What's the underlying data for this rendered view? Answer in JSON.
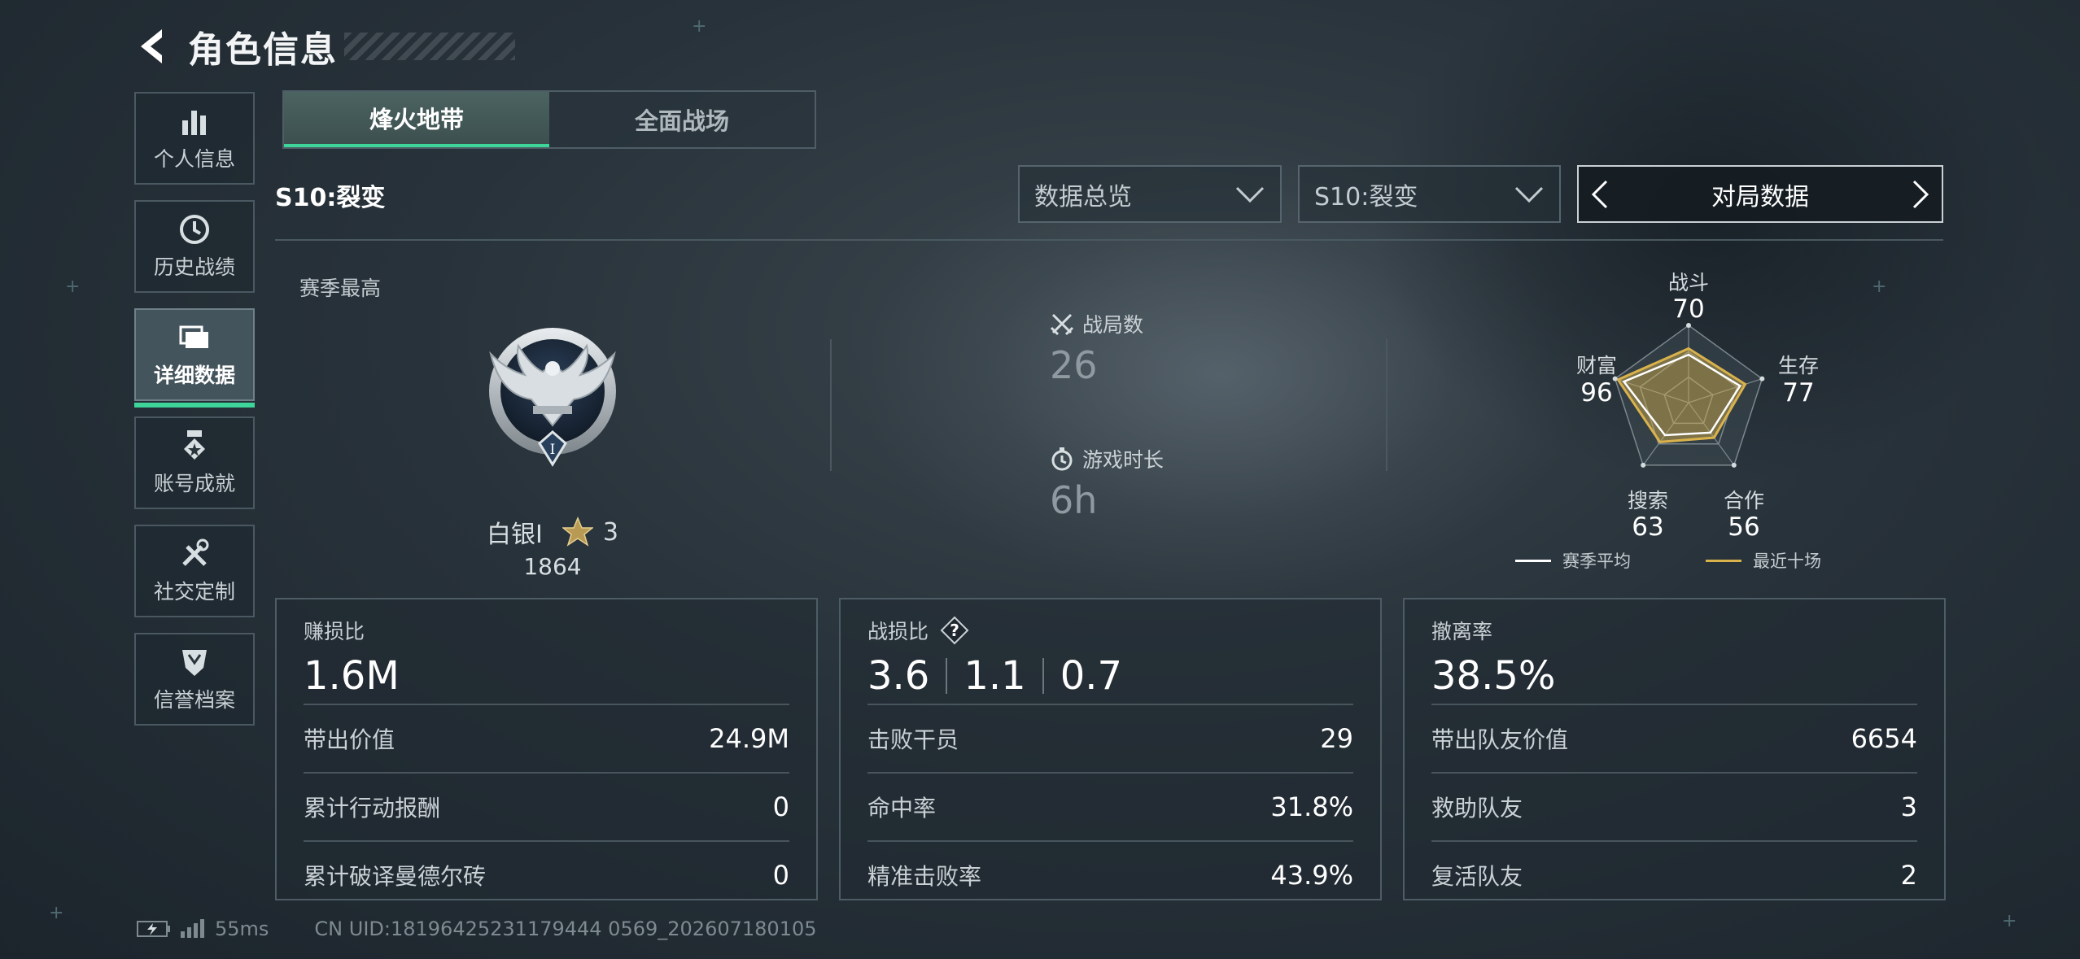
{
  "header": {
    "title": "角色信息"
  },
  "nav": {
    "items": [
      {
        "label": "个人信息",
        "icon": "bar-chart-icon"
      },
      {
        "label": "历史战绩",
        "icon": "clock-icon"
      },
      {
        "label": "详细数据",
        "icon": "folder-icon",
        "active": true
      },
      {
        "label": "账号成就",
        "icon": "medal-icon"
      },
      {
        "label": "社交定制",
        "icon": "tools-icon"
      },
      {
        "label": "信誉档案",
        "icon": "shield-icon"
      }
    ]
  },
  "mode_tabs": [
    {
      "label": "烽火地带",
      "active": true
    },
    {
      "label": "全面战场",
      "active": false
    }
  ],
  "season_label": "S10:裂变",
  "filters": {
    "overview": "数据总览",
    "season": "S10:裂变",
    "pager_label": "对局数据"
  },
  "overview": {
    "season_best_label": "赛季最高",
    "rank_name": "白银I",
    "rank_stars": "3",
    "rank_score": "1864",
    "badge_numeral": "I",
    "matches_label": "战局数",
    "matches_value": "26",
    "playtime_label": "游戏时长",
    "playtime_value": "6h"
  },
  "radar": {
    "axes": [
      {
        "label": "战斗",
        "value": "70"
      },
      {
        "label": "生存",
        "value": "77"
      },
      {
        "label": "合作",
        "value": "56"
      },
      {
        "label": "搜索",
        "value": "63"
      },
      {
        "label": "财富",
        "value": "96"
      }
    ],
    "season_avg": [
      0.62,
      0.7,
      0.48,
      0.52,
      0.88
    ],
    "recent_ten": [
      0.7,
      0.77,
      0.56,
      0.63,
      0.96
    ],
    "legend": {
      "season_avg": "赛季平均",
      "recent_ten": "最近十场"
    },
    "colors": {
      "season_avg": "#ffffff",
      "recent_ten": "#d9b24c"
    }
  },
  "cards": [
    {
      "title": "赚损比",
      "main": [
        "1.6M"
      ],
      "rows": [
        {
          "label": "带出价值",
          "value": "24.9M"
        },
        {
          "label": "累计行动报酬",
          "value": "0"
        },
        {
          "label": "累计破译曼德尔砖",
          "value": "0"
        }
      ]
    },
    {
      "title": "战损比",
      "help_icon": "?",
      "main": [
        "3.6",
        "1.1",
        "0.7"
      ],
      "rows": [
        {
          "label": "击败干员",
          "value": "29"
        },
        {
          "label": "命中率",
          "value": "31.8%"
        },
        {
          "label": "精准击败率",
          "value": "43.9%"
        }
      ]
    },
    {
      "title": "撤离率",
      "main": [
        "38.5%"
      ],
      "rows": [
        {
          "label": "带出队友价值",
          "value": "6654"
        },
        {
          "label": "救助队友",
          "value": "3"
        },
        {
          "label": "复活队友",
          "value": "2"
        }
      ]
    }
  ],
  "status": {
    "ping": "55ms",
    "uid": "CN UID:18196425231179444 0569_202607180105"
  }
}
